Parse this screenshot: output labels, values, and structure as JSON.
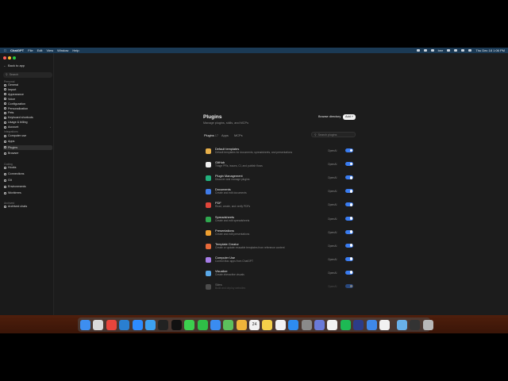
{
  "menubar": {
    "app": "ChatGPT",
    "menus": [
      "File",
      "Edit",
      "View",
      "Window",
      "Help"
    ],
    "clock": "Thu Dec 18  1:06 PM",
    "battery_label": "bee"
  },
  "sidebar": {
    "back_label": "Back to app",
    "search_placeholder": "Search",
    "sections": {
      "personal": "Personal",
      "integrations": "Integrations",
      "coding": "Coding",
      "archived": "Archived"
    },
    "personal_items": [
      "General",
      "Import",
      "Appearance",
      "Voice",
      "Configuration",
      "Personalization",
      "Pets",
      "Keyboard shortcuts",
      "Usage & billing",
      "Account"
    ],
    "integration_items": [
      "Computer use",
      "Apps",
      "Plugins",
      "Browser"
    ],
    "coding_items": [
      "Hooks",
      "Connections",
      "Git",
      "Environments",
      "Worktrees"
    ],
    "archived_items": [
      "Archived chats"
    ]
  },
  "main": {
    "title": "Plugins",
    "subtitle": "Manage plugins, skills, and MCPs",
    "browse_label": "Browse directory",
    "add_label": "Add",
    "tabs": [
      {
        "label": "Plugins",
        "count": "17"
      },
      {
        "label": "Apps",
        "count": ""
      },
      {
        "label": "MCPs",
        "count": ""
      }
    ],
    "search_placeholder": "Search plugins",
    "plugins": [
      {
        "name": "Default templates",
        "desc": "Default templates for documents, spreadsheets, and presentations",
        "provider": "OpenAI",
        "color": "#e8b04a"
      },
      {
        "name": "GitHub",
        "desc": "Triage PRs, issues, CI, and publish flows",
        "provider": "OpenAI",
        "color": "#f0f0f0"
      },
      {
        "name": "Plugin Management",
        "desc": "Discover and manage plugins",
        "provider": "OpenAI",
        "color": "#22b07d"
      },
      {
        "name": "Documents",
        "desc": "Create and edit documents",
        "provider": "OpenAI",
        "color": "#3f7be8"
      },
      {
        "name": "PDF",
        "desc": "Read, create, and verify PDFs",
        "provider": "OpenAI",
        "color": "#e0453a"
      },
      {
        "name": "Spreadsheets",
        "desc": "Create and edit spreadsheets",
        "provider": "OpenAI",
        "color": "#2fa84f"
      },
      {
        "name": "Presentations",
        "desc": "Create and edit presentations",
        "provider": "OpenAI",
        "color": "#f0a030"
      },
      {
        "name": "Template Creator",
        "desc": "Create or update reusable templates from reference content",
        "provider": "OpenAI",
        "color": "#e86a3a"
      },
      {
        "name": "Computer Use",
        "desc": "Control Mac apps from ChatGPT",
        "provider": "OpenAI",
        "color": "#a77de8"
      },
      {
        "name": "Visualize",
        "desc": "Create interactive visuals",
        "provider": "OpenAI",
        "color": "#5aa8e8"
      },
      {
        "name": "Sites",
        "desc": "Build and deploy websites",
        "provider": "OpenAI",
        "color": "#888888"
      }
    ]
  },
  "dock": {
    "icons": [
      {
        "name": "finder",
        "color": "#3d8ef0"
      },
      {
        "name": "launchpad",
        "color": "#d9d9d9"
      },
      {
        "name": "chrome",
        "color": "#e8453c"
      },
      {
        "name": "vscode",
        "color": "#2a7fd0"
      },
      {
        "name": "zoom",
        "color": "#2d8cff"
      },
      {
        "name": "safari",
        "color": "#3da0f0"
      },
      {
        "name": "terminal",
        "color": "#222222"
      },
      {
        "name": "chatgpt",
        "color": "#111111"
      },
      {
        "name": "messages",
        "color": "#3ccf4e"
      },
      {
        "name": "facetime",
        "color": "#2fbf47"
      },
      {
        "name": "mail",
        "color": "#3a8cf0"
      },
      {
        "name": "maps",
        "color": "#5cc05c"
      },
      {
        "name": "photos",
        "color": "#f0b43a"
      },
      {
        "name": "calendar",
        "color": "#f2f2f2"
      },
      {
        "name": "notes",
        "color": "#f5d04a"
      },
      {
        "name": "reminders",
        "color": "#f2f2f2"
      },
      {
        "name": "app-store",
        "color": "#2d8cf0"
      },
      {
        "name": "system-settings",
        "color": "#8a8a8a"
      },
      {
        "name": "preview",
        "color": "#6a7ad8"
      },
      {
        "name": "notion",
        "color": "#f2f2f2"
      },
      {
        "name": "spotify",
        "color": "#1db954"
      },
      {
        "name": "chatgpt-alt",
        "color": "#2c3c88"
      },
      {
        "name": "quicktime",
        "color": "#3f88e8"
      },
      {
        "name": "openai",
        "color": "#f2f2f2"
      }
    ],
    "right_icons": [
      {
        "name": "downloads-folder",
        "color": "#6ab0e8"
      },
      {
        "name": "screenshot-folder",
        "color": "#333333"
      },
      {
        "name": "trash",
        "color": "#b8b8b8"
      }
    ],
    "calendar_day": "24"
  }
}
